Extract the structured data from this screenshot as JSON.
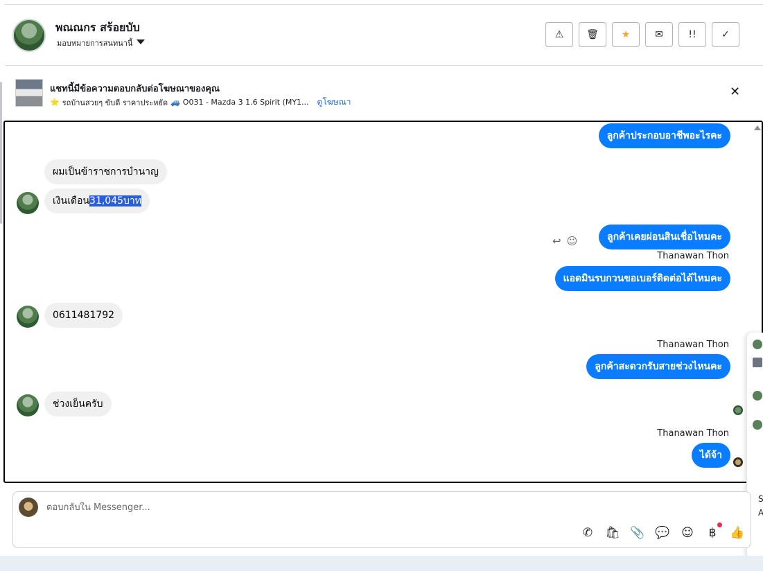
{
  "header": {
    "name": "พณณกร สร้อยบับ",
    "assign_label": "มอบหมายการสนทนานี้",
    "actions": [
      {
        "icon": "warning-icon",
        "glyph": "⚠"
      },
      {
        "icon": "trash-icon",
        "glyph": "🗑"
      },
      {
        "icon": "star-icon",
        "glyph": "★"
      },
      {
        "icon": "mail-icon",
        "glyph": "✉"
      },
      {
        "icon": "priority-icon",
        "glyph": "!!"
      },
      {
        "icon": "check-icon",
        "glyph": "✓"
      }
    ]
  },
  "ad": {
    "title": "แชทนี้มีข้อความตอบกลับต่อโฆษณาของคุณ",
    "star": "⭐",
    "line_text": "รถบ้านสวยๆ ขับดี ราคาประหยัด",
    "car_emoji": "🚙",
    "ad_name": "O031 - Mazda 3 1.6 Spirit (MY1...",
    "view_ad": "ดูโฆษณา",
    "close": "✕"
  },
  "messages": {
    "m1": "ลูกค้าประกอบอาชีพอะไรคะ",
    "m2": "ผมเป็นข้าราชการบำนาญ",
    "m3_prefix": "เงินเดือน",
    "m3_selected": "31,045บาท",
    "m4": "ลูกค้าเคยผ่อนสินเชื่อไหมคะ",
    "sender": "Thanawan Thon",
    "m5": "แอดมินรบกวนขอเบอร์ติดต่อได้ไหมคะ",
    "m6": "0611481792",
    "m7": "ลูกค้าสะดวกรับสายช่วงไหนคะ",
    "m8": "ช่วงเย็นครับ",
    "m9": "ได้จ้า",
    "reply_icon": "↩",
    "react_icon": "☺"
  },
  "side_peek": {
    "text_s": "S",
    "text_a": "A"
  },
  "composer": {
    "placeholder": "ตอบกลับใน Messenger...",
    "tools": [
      {
        "icon": "call-add-icon",
        "glyph": "✆"
      },
      {
        "icon": "shopping-bag-icon",
        "glyph": "🛍"
      },
      {
        "icon": "attach-icon",
        "glyph": "📎"
      },
      {
        "icon": "saved-reply-icon",
        "glyph": "💬"
      },
      {
        "icon": "emoji-icon",
        "glyph": "☺"
      },
      {
        "icon": "baht-icon",
        "glyph": "฿"
      },
      {
        "icon": "like-icon",
        "glyph": "👍"
      }
    ]
  }
}
